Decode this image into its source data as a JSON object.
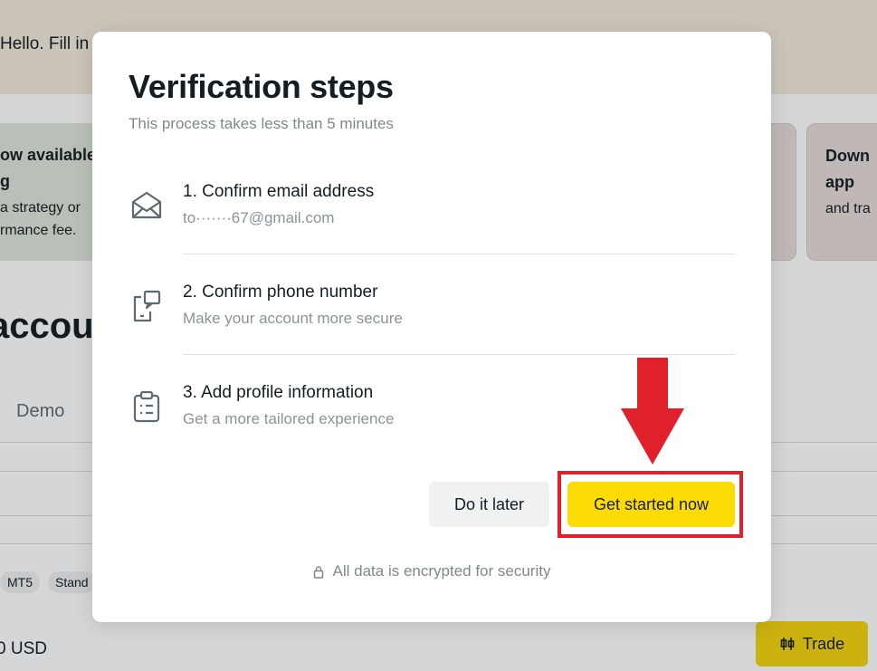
{
  "background": {
    "banner_text": "Hello. Fill in",
    "promo_left": {
      "title_line1": "ow available",
      "title_line2": "g",
      "body_line1": "a strategy or",
      "body_line2": "rmance fee."
    },
    "promo_right": {
      "title_line1": "Down",
      "title_line2": "app",
      "body_line1": "and tra"
    },
    "heading": "accou",
    "tab_demo": "Demo",
    "chips": [
      "MT5",
      "Stand"
    ],
    "balance": "0 USD",
    "trade_button": "Trade"
  },
  "modal": {
    "title": "Verification steps",
    "subtitle": "This process takes less than 5 minutes",
    "steps": [
      {
        "title": "1. Confirm email address",
        "description": "to·······67@gmail.com",
        "icon": "envelope-icon"
      },
      {
        "title": "2. Confirm phone number",
        "description": "Make your account more secure",
        "icon": "phone-chat-icon"
      },
      {
        "title": "3. Add profile information",
        "description": "Get a more tailored experience",
        "icon": "clipboard-icon"
      }
    ],
    "buttons": {
      "later": "Do it later",
      "start": "Get started now"
    },
    "security_note": "All data is encrypted for security"
  },
  "colors": {
    "primary_button": "#fcdc04",
    "annotation_red": "#e0202b",
    "banner_bg": "#f3ead9"
  }
}
